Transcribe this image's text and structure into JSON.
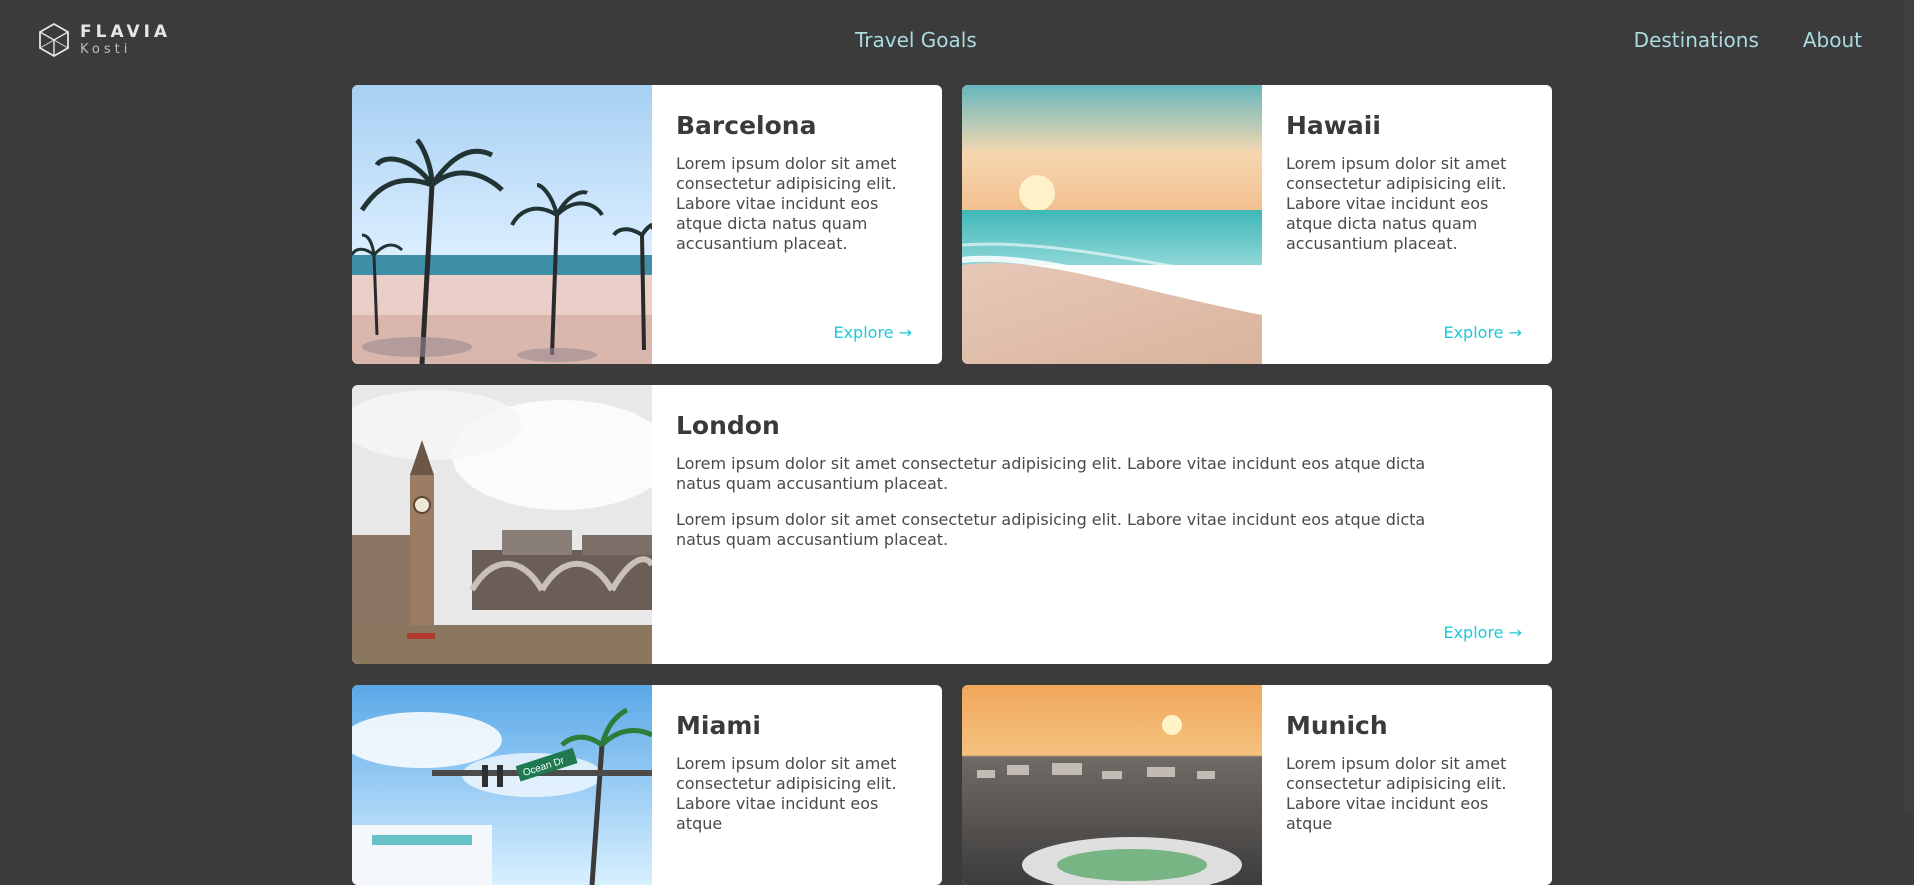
{
  "brand": {
    "name": "FLAVIA",
    "sub": "Kosti"
  },
  "nav": {
    "center": "Travel Goals",
    "right": [
      "Destinations",
      "About"
    ]
  },
  "cards": [
    {
      "title": "Barcelona",
      "body": "Lorem ipsum dolor sit amet consectetur adipisicing elit. Labore vitae incidunt eos atque dicta natus quam accusantium placeat.",
      "cta": "Explore →"
    },
    {
      "title": "Hawaii",
      "body": "Lorem ipsum dolor sit amet consectetur adipisicing elit. Labore vitae incidunt eos atque dicta natus quam accusantium placeat.",
      "cta": "Explore →"
    },
    {
      "title": "London",
      "body": "Lorem ipsum dolor sit amet consectetur adipisicing elit. Labore vitae incidunt eos atque dicta natus quam accusantium placeat.",
      "body2": "Lorem ipsum dolor sit amet consectetur adipisicing elit. Labore vitae incidunt eos atque dicta natus quam accusantium placeat.",
      "cta": "Explore →"
    },
    {
      "title": "Miami",
      "body": "Lorem ipsum dolor sit amet consectetur adipisicing elit. Labore vitae incidunt eos atque"
    },
    {
      "title": "Munich",
      "body": "Lorem ipsum dolor sit amet consectetur adipisicing elit. Labore vitae incidunt eos atque"
    }
  ],
  "miami_sign": "Ocean Dr",
  "colors": {
    "background": "#3b3b3b",
    "accent": "#1dc9d8",
    "nav": "#a9dbe0"
  }
}
